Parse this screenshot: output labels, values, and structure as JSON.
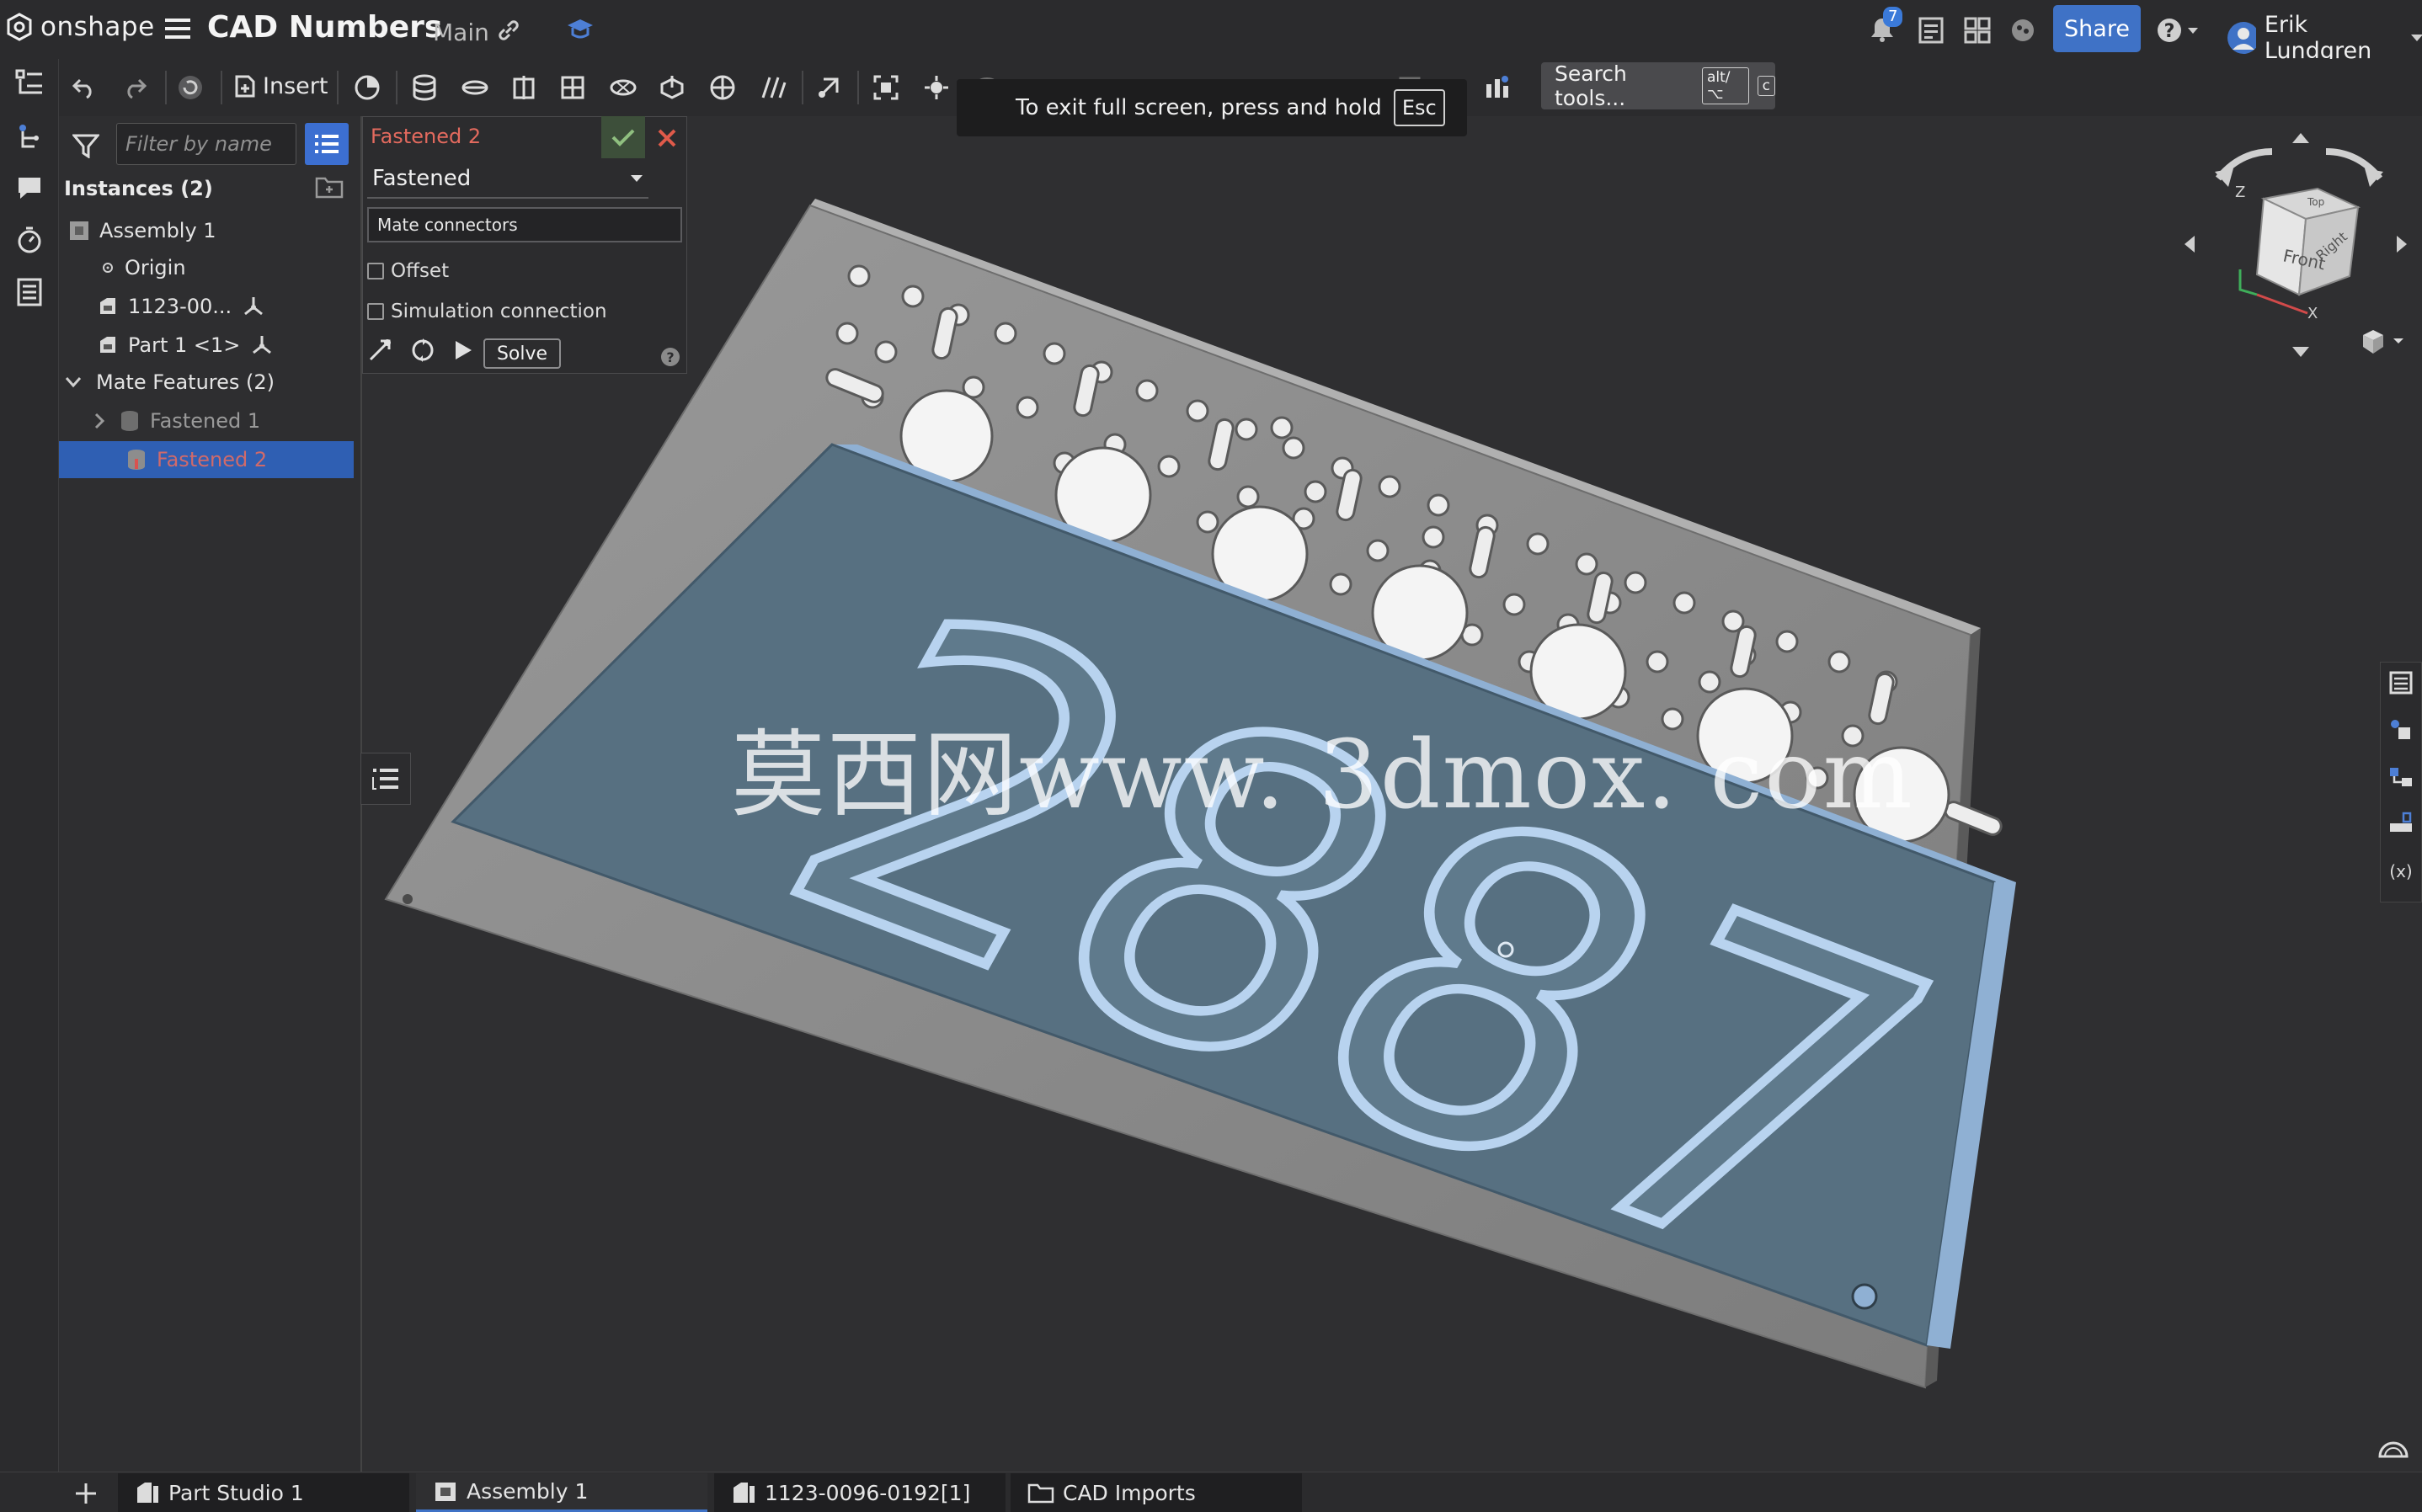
{
  "app": {
    "logo_text": "onshape",
    "document_title": "CAD Numbers",
    "branch": "Main",
    "notification_count": "7",
    "share_label": "Share",
    "user_name": "Erik Lundgren"
  },
  "toolbar": {
    "insert_label": "Insert",
    "search_label": "Search tools...",
    "search_shortcut_1": "alt/⌥",
    "search_shortcut_2": "c",
    "fullscreen_message": "To exit full screen, press and hold",
    "fullscreen_key": "Esc"
  },
  "feature_panel": {
    "filter_placeholder": "Filter by name",
    "instances_header": "Instances (2)",
    "items": [
      {
        "label": "Assembly 1"
      },
      {
        "label": "Origin"
      },
      {
        "label": "1123-00..."
      },
      {
        "label": "Part 1 <1>"
      },
      {
        "label": "Mate Features (2)"
      },
      {
        "label": "Fastened 1"
      },
      {
        "label": "Fastened 2"
      }
    ]
  },
  "mate_dialog": {
    "title": "Fastened 2",
    "type": "Fastened",
    "connectors_placeholder": "Mate connectors",
    "offset_label": "Offset",
    "simulation_label": "Simulation connection",
    "solve_label": "Solve"
  },
  "viewport": {
    "watermark": "莫西网www. 3dmox. com",
    "model_digits": [
      "2",
      "8",
      "8",
      "7"
    ]
  },
  "view_cube": {
    "front": "Front",
    "right": "Right",
    "top": "Top",
    "axis_z": "Z",
    "axis_x": "X"
  },
  "tabs": [
    {
      "label": "Part Studio 1",
      "active": false
    },
    {
      "label": "Assembly 1",
      "active": true
    },
    {
      "label": "1123-0096-0192[1]",
      "active": false
    },
    {
      "label": "CAD Imports",
      "active": false
    }
  ],
  "colors": {
    "accent": "#3f72c6",
    "selection": "#2f5fb3",
    "error_text": "#e36a5e",
    "plate": "#8a8a8a",
    "sign": "#577081"
  }
}
